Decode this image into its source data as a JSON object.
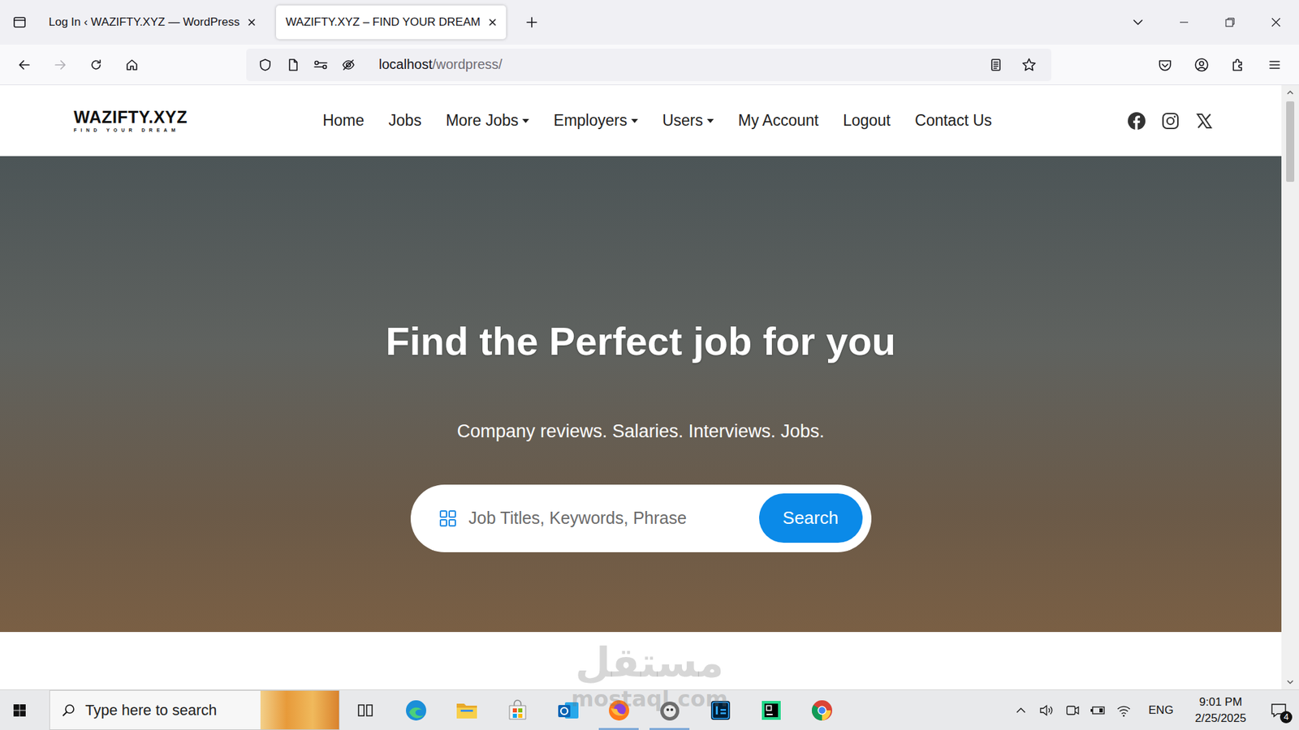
{
  "browser": {
    "tabs": [
      {
        "label": "Log In ‹ WAZIFTY.XYZ — WordPress",
        "selected": false
      },
      {
        "label": "WAZIFTY.XYZ – FIND YOUR DREAM",
        "selected": true
      }
    ],
    "nav_buttons": {
      "back_enabled": true,
      "forward_enabled": false
    },
    "address": {
      "host": "localhost",
      "path": "/wordpress/"
    }
  },
  "page": {
    "logo": {
      "name": "WAZIFTY.XYZ",
      "tagline": "FIND YOUR DREAM"
    },
    "menu": [
      {
        "label": "Home",
        "dropdown": false
      },
      {
        "label": "Jobs",
        "dropdown": false
      },
      {
        "label": "More Jobs",
        "dropdown": true
      },
      {
        "label": "Employers",
        "dropdown": true
      },
      {
        "label": "Users",
        "dropdown": true
      },
      {
        "label": "My Account",
        "dropdown": false
      },
      {
        "label": "Logout",
        "dropdown": false
      },
      {
        "label": "Contact Us",
        "dropdown": false
      }
    ],
    "hero": {
      "title": "Find the Perfect job for you",
      "subtitle": "Company reviews. Salaries. Interviews. Jobs.",
      "search": {
        "placeholder": "Job Titles, Keywords, Phrase",
        "button": "Search"
      }
    },
    "scrollbar": {
      "level": 0.14
    }
  },
  "watermark": {
    "arabic": "مستقل",
    "latin": "mostaql.com"
  },
  "taskbar": {
    "search_placeholder": "Type here to search",
    "apps": [
      {
        "running": false
      },
      {
        "running": false
      },
      {
        "running": false
      },
      {
        "running": false
      },
      {
        "running": false
      },
      {
        "running": true
      },
      {
        "running": true
      },
      {
        "running": false
      },
      {
        "running": false
      },
      {
        "running": false
      }
    ],
    "tray": {
      "language": "ENG",
      "time": "9:01 PM",
      "date": "2/25/2025",
      "notifications": "4"
    }
  }
}
